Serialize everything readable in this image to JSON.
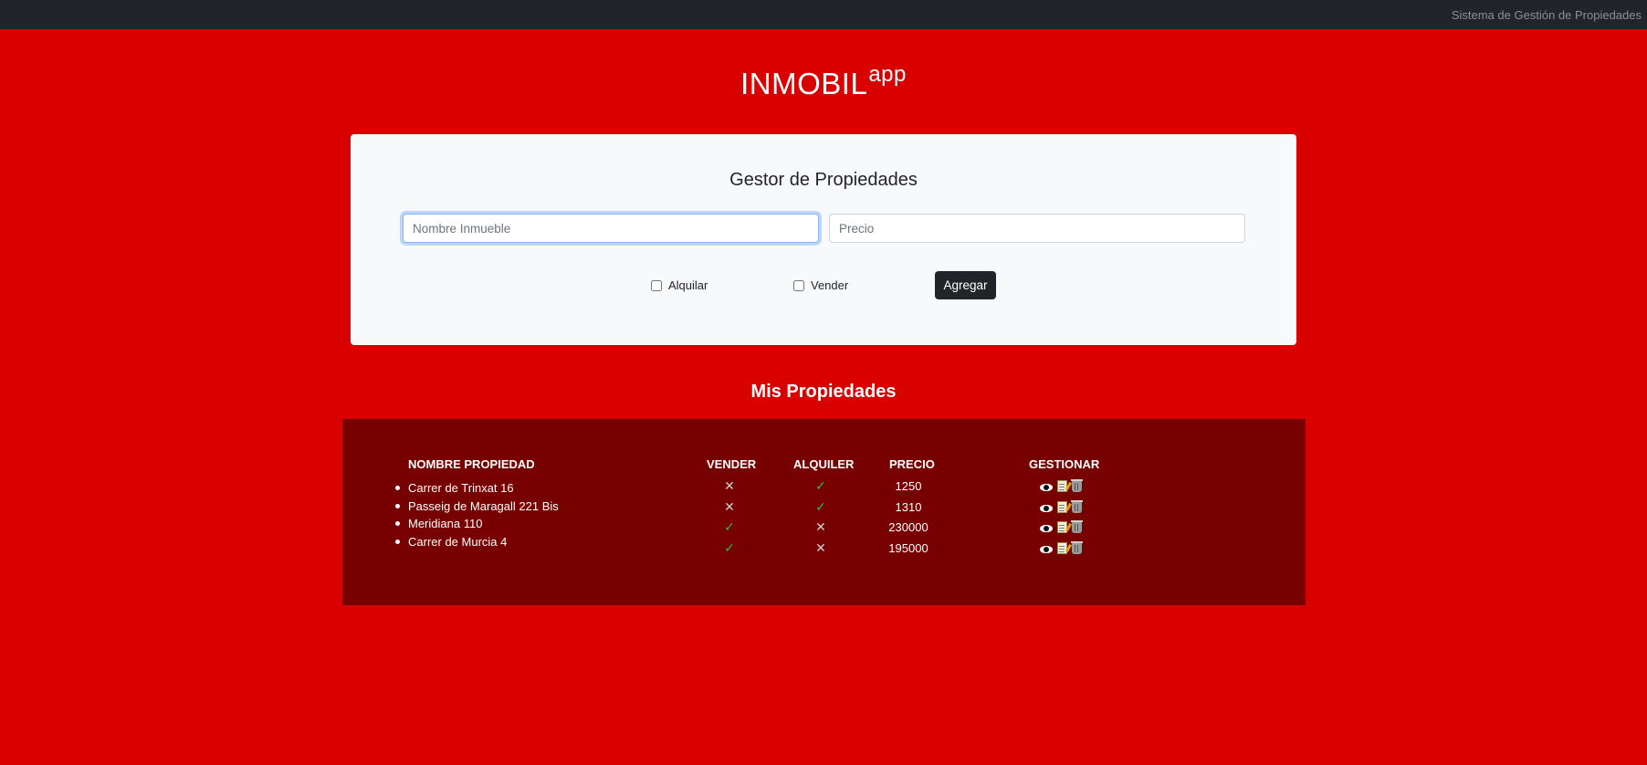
{
  "topbar": {
    "title": "Sistema de Gestión de Propiedades"
  },
  "brand": {
    "main": "INMOBIL",
    "sup": "app"
  },
  "form": {
    "title": "Gestor de Propiedades",
    "nombre_placeholder": "Nombre Inmueble",
    "precio_placeholder": "Precio",
    "alquilar_label": "Alquilar",
    "vender_label": "Vender",
    "agregar_label": "Agregar"
  },
  "propiedades": {
    "title": "Mis Propiedades",
    "headers": {
      "nombre": "NOMBRE PROPIEDAD",
      "vender": "VENDER",
      "alquiler": "ALQUILER",
      "precio": "PRECIO",
      "gestionar": "GESTIONAR"
    },
    "nombres": [
      "Carrer de Trinxat 16",
      "Passeig de Maragall 221 Bis",
      "Meridiana 110",
      "Carrer de Murcia 4"
    ],
    "filas": [
      {
        "vender": "✕",
        "alquiler": "✓",
        "precio": "1250"
      },
      {
        "vender": "✕",
        "alquiler": "✓",
        "precio": "1310"
      },
      {
        "vender": "✓",
        "alquiler": "✕",
        "precio": "230000"
      },
      {
        "vender": "✓",
        "alquiler": "✕",
        "precio": "195000"
      }
    ]
  },
  "icons": {
    "view": "eye-icon",
    "edit": "edit-icon",
    "delete": "trash-icon"
  },
  "colors": {
    "background": "#d90000",
    "panel": "#770000",
    "topbar": "#212529",
    "tick": "#2fbf3a"
  }
}
